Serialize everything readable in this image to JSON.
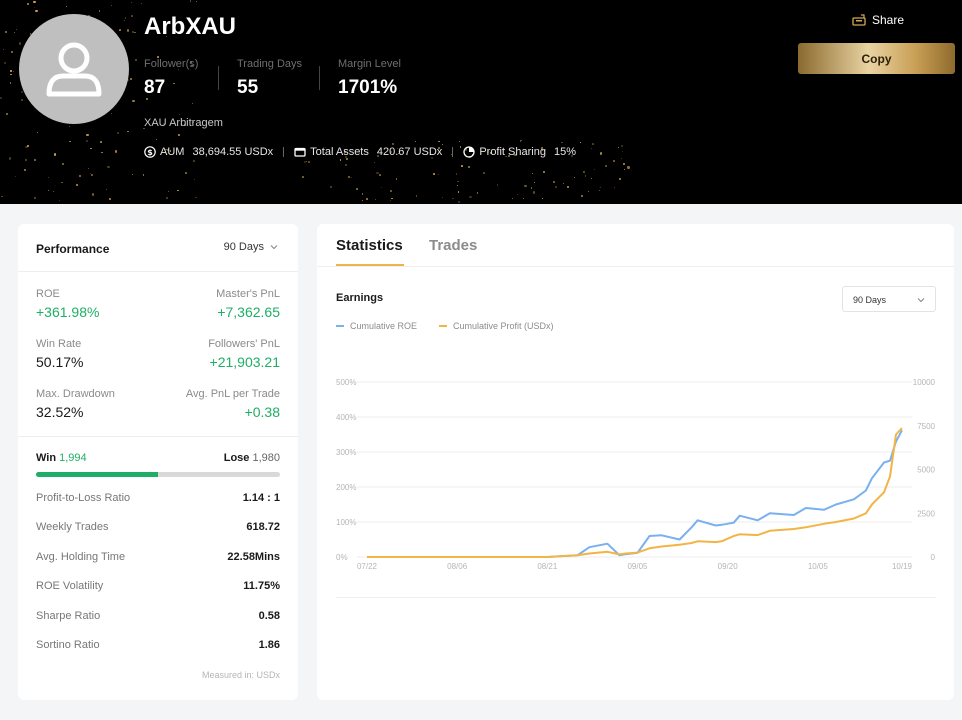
{
  "profile": {
    "name": "ArbXAU",
    "description": "XAU Arbitragem",
    "stats": [
      {
        "label": "Follower(s)",
        "value": "87"
      },
      {
        "label": "Trading Days",
        "value": "55"
      },
      {
        "label": "Margin Level",
        "value": "1701%"
      }
    ],
    "info": {
      "aum_label": "AUM",
      "aum_value": "38,694.55 USDx",
      "assets_label": "Total Assets",
      "assets_value": "420.67 USDx",
      "sharing_label": "Profit Sharing",
      "sharing_value": "15%"
    },
    "share_label": "Share",
    "copy_label": "Copy"
  },
  "performance": {
    "title": "Performance",
    "period": "90 Days",
    "metrics": {
      "roe_label": "ROE",
      "roe_value": "+361.98%",
      "master_pnl_label": "Master's PnL",
      "master_pnl_value": "+7,362.65",
      "win_rate_label": "Win Rate",
      "win_rate_value": "50.17%",
      "followers_pnl_label": "Followers' PnL",
      "followers_pnl_value": "+21,903.21",
      "drawdown_label": "Max. Drawdown",
      "drawdown_value": "32.52%",
      "avg_pnl_label": "Avg. PnL per Trade",
      "avg_pnl_value": "+0.38"
    },
    "win_label": "Win",
    "win_count": "1,994",
    "lose_label": "Lose",
    "lose_count": "1,980",
    "win_fraction": 0.502,
    "rows": [
      {
        "label": "Profit-to-Loss Ratio",
        "value": "1.14 : 1"
      },
      {
        "label": "Weekly Trades",
        "value": "618.72"
      },
      {
        "label": "Avg. Holding Time",
        "value": "22.58Mins"
      },
      {
        "label": "ROE Volatility",
        "value": "11.75%"
      },
      {
        "label": "Sharpe Ratio",
        "value": "0.58"
      },
      {
        "label": "Sortino Ratio",
        "value": "1.86"
      }
    ],
    "measured": "Measured in: USDx"
  },
  "statistics": {
    "tabs": [
      "Statistics",
      "Trades"
    ],
    "earnings_title": "Earnings",
    "period": "90 Days"
  },
  "colors": {
    "roe_line": "#79b0f0",
    "profit_line": "#f2b445",
    "positive": "#1fae65"
  },
  "chart_data": {
    "type": "line",
    "x_ticks": [
      "07/22",
      "08/06",
      "08/21",
      "09/05",
      "09/20",
      "10/05",
      "10/19"
    ],
    "left_axis": {
      "ticks": [
        "0%",
        "100%",
        "200%",
        "300%",
        "400%",
        "500%"
      ],
      "ylim": [
        0,
        500
      ]
    },
    "right_axis": {
      "ticks": [
        "0",
        "2500",
        "5000",
        "7500",
        "10000"
      ],
      "ylim": [
        0,
        10000
      ]
    },
    "grid": true,
    "legend_position": "top-left",
    "series": [
      {
        "name": "Cumulative ROE",
        "axis": "left",
        "x": [
          "07/22",
          "08/06",
          "08/21",
          "08/26",
          "08/28",
          "08/31",
          "09/02",
          "09/03",
          "09/05",
          "09/07",
          "09/09",
          "09/12",
          "09/14",
          "09/15",
          "09/18",
          "09/19",
          "09/21",
          "09/22",
          "09/25",
          "09/27",
          "10/01",
          "10/03",
          "10/06",
          "10/08",
          "10/11",
          "10/13",
          "10/14",
          "10/16",
          "10/17",
          "10/18",
          "10/19"
        ],
        "y": [
          0,
          0,
          0,
          5,
          28,
          38,
          5,
          8,
          12,
          60,
          62,
          50,
          85,
          105,
          90,
          92,
          98,
          118,
          105,
          125,
          120,
          140,
          135,
          150,
          165,
          190,
          225,
          270,
          275,
          330,
          362
        ]
      },
      {
        "name": "Cumulative Profit (USDx)",
        "axis": "right",
        "x": [
          "07/22",
          "08/06",
          "08/21",
          "08/26",
          "08/28",
          "08/31",
          "09/02",
          "09/03",
          "09/05",
          "09/07",
          "09/09",
          "09/12",
          "09/14",
          "09/15",
          "09/18",
          "09/19",
          "09/21",
          "09/22",
          "09/25",
          "09/27",
          "10/01",
          "10/03",
          "10/06",
          "10/08",
          "10/11",
          "10/13",
          "10/14",
          "10/16",
          "10/17",
          "10/18",
          "10/19"
        ],
        "y": [
          0,
          0,
          0,
          100,
          200,
          300,
          150,
          200,
          250,
          500,
          600,
          700,
          800,
          900,
          850,
          900,
          1200,
          1300,
          1250,
          1500,
          1600,
          1700,
          1900,
          2000,
          2200,
          2500,
          3000,
          3700,
          4600,
          7000,
          7363
        ]
      }
    ]
  }
}
